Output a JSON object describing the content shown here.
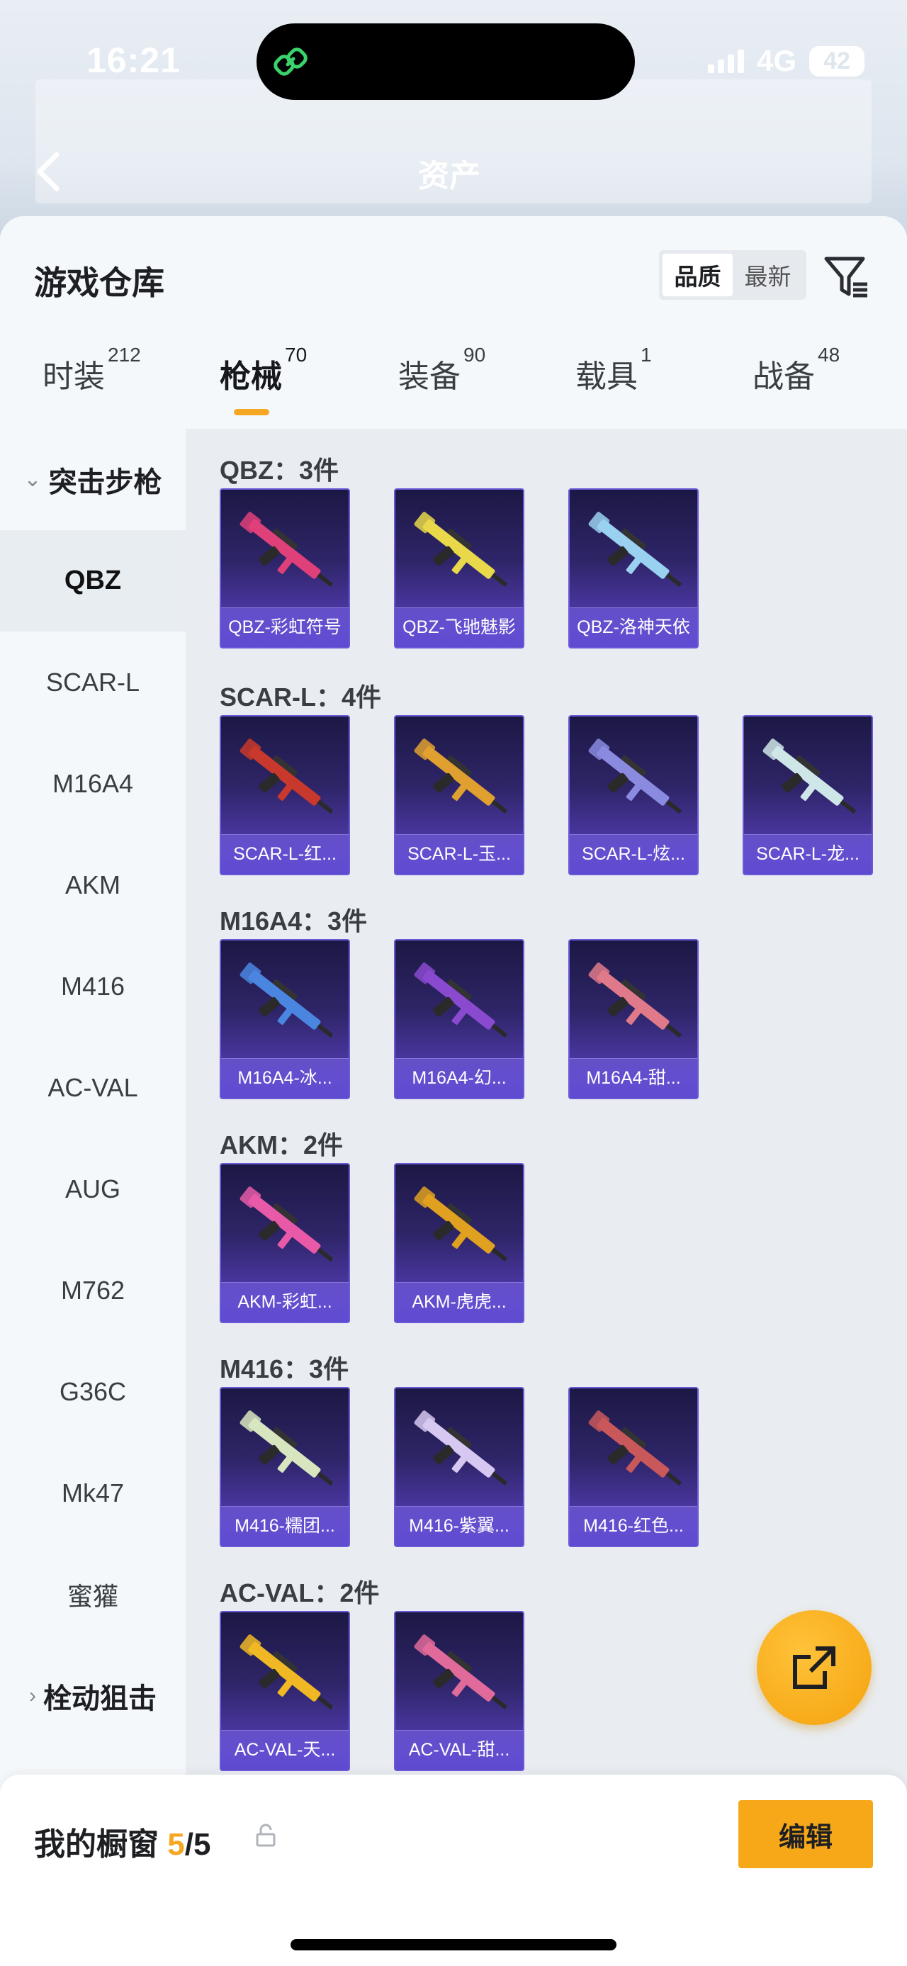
{
  "status_bar": {
    "time": "16:21",
    "network": "4G",
    "battery": "42"
  },
  "header": {
    "back_icon": "back-arrow-icon",
    "title": "资产"
  },
  "warehouse": {
    "title": "游戏仓库",
    "sort_options": [
      "品质",
      "最新"
    ],
    "sort_selected": "品质",
    "filter_icon": "filter-icon"
  },
  "tabs": [
    {
      "label": "时装",
      "count": "212"
    },
    {
      "label": "枪械",
      "count": "70"
    },
    {
      "label": "装备",
      "count": "90"
    },
    {
      "label": "载具",
      "count": "1"
    },
    {
      "label": "战备",
      "count": "48"
    }
  ],
  "active_tab": "枪械",
  "sidebar": {
    "category_open": "突击步枪",
    "items": [
      "QBZ",
      "SCAR-L",
      "M16A4",
      "AKM",
      "M416",
      "AC-VAL",
      "AUG",
      "M762",
      "G36C",
      "Mk47",
      "蜜獾"
    ],
    "active_item": "QBZ",
    "category_closed": "栓动狙击"
  },
  "groups": [
    {
      "title": "QBZ：3件",
      "items": [
        {
          "label": "QBZ-彩虹符号",
          "gun": "#e0407a"
        },
        {
          "label": "QBZ-飞驰魅影",
          "gun": "#e8d84a"
        },
        {
          "label": "QBZ-洛神天依",
          "gun": "#9ad0f0"
        }
      ]
    },
    {
      "title": "SCAR-L：4件",
      "items": [
        {
          "label": "SCAR-L-红...",
          "gun": "#c8382c"
        },
        {
          "label": "SCAR-L-玉...",
          "gun": "#e0a030"
        },
        {
          "label": "SCAR-L-炫...",
          "gun": "#8a8ae0"
        },
        {
          "label": "SCAR-L-龙...",
          "gun": "#cfe6e8"
        }
      ]
    },
    {
      "title": "M16A4：3件",
      "items": [
        {
          "label": "M16A4-冰...",
          "gun": "#4a86e0"
        },
        {
          "label": "M16A4-幻...",
          "gun": "#8a4ad0"
        },
        {
          "label": "M16A4-甜...",
          "gun": "#e07a8a"
        }
      ]
    },
    {
      "title": "AKM：2件",
      "items": [
        {
          "label": "AKM-彩虹...",
          "gun": "#e85aa8"
        },
        {
          "label": "AKM-虎虎...",
          "gun": "#e0a020"
        }
      ]
    },
    {
      "title": "M416：3件",
      "items": [
        {
          "label": "M416-糯团...",
          "gun": "#d8e6c0"
        },
        {
          "label": "M416-紫翼...",
          "gun": "#d6c8f0"
        },
        {
          "label": "M416-红色...",
          "gun": "#c8585a"
        }
      ]
    },
    {
      "title": "AC-VAL：2件",
      "items": [
        {
          "label": "AC-VAL-天...",
          "gun": "#f0b824"
        },
        {
          "label": "AC-VAL-甜...",
          "gun": "#e06a9a"
        }
      ]
    }
  ],
  "fab_icon": "share-external-icon",
  "showcase": {
    "title": "我的橱窗",
    "used": "5",
    "sep_total": "/5",
    "lock_icon": "lock-icon",
    "edit_label": "编辑"
  }
}
